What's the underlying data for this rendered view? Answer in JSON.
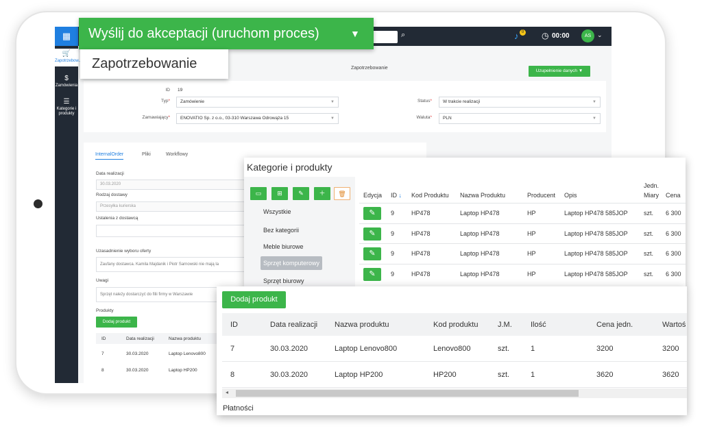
{
  "callout": {
    "label": "Wyślij do akceptacji (uruchom proces)"
  },
  "title_label": "Zapotrzebowanie",
  "topbar": {
    "timer": "00:00",
    "notif_count": "0",
    "avatar_initials": "AS"
  },
  "sidebar": {
    "items": [
      {
        "label": "Zapotrzebow..."
      },
      {
        "label": "Zamówienia"
      },
      {
        "label": "Kategorie i produkty"
      }
    ]
  },
  "page": {
    "title": "Zapotrzebowanie",
    "supplement_button": "Uzupełnienie danych ▼"
  },
  "form": {
    "id_label": "ID",
    "id_value": "19",
    "typ_label": "Typ",
    "typ_value": "Zamówienie",
    "zamawiajacy_label": "Zamawiający",
    "zamawiajacy_value": "ENOVATIO Sp. z o.o., 03-310 Warszawa Odrowąża 15",
    "status_label": "Status",
    "status_value": "W trakcie realizacji",
    "waluta_label": "Waluta",
    "waluta_value": "PLN"
  },
  "lower": {
    "tabs": [
      "InternalOrder",
      "Pliki",
      "Workflowy"
    ],
    "data_realizacji_label": "Data realizacji",
    "data_realizacji_value": "30.03.2020",
    "rodzaj_dostawy_label": "Rodzaj dostawy",
    "rodzaj_dostawy_value": "Przesyłka kurierska",
    "ustalenia_label": "Ustalenia z dostawcą",
    "ustalenia_value": "",
    "uzasadnienie_label": "Uzasadnienie wyboru oferty",
    "uzasadnienie_value": "Zaufany dostawca. Kamila Majdanik i Piotr Sarnowski nie mają la",
    "uwagi_label": "Uwagi",
    "uwagi_value": "Sprzęt należy dostarczyć do filii firmy w Warszawie",
    "produkty_label": "Produkty",
    "add_product": "Dodaj produkt",
    "table_headers": [
      "ID",
      "Data realizacji",
      "Nazwa produktu"
    ],
    "rows": [
      [
        "7",
        "30.03.2020",
        "Laptop Lenovo800"
      ],
      [
        "8",
        "30.03.2020",
        "Laptop HP200"
      ]
    ]
  },
  "categories": {
    "title": "Kategorie i produkty",
    "items": [
      "Wszystkie",
      "Bez kategorii",
      "Meble biurowe",
      "Sprzęt komputerowy",
      "Sprzęt biurowy"
    ],
    "headers": [
      "Edycja",
      "ID",
      "Kod Produktu",
      "Nazwa Produktu",
      "Producent",
      "Opis",
      "Jedn.",
      "Miary",
      "Cena"
    ],
    "rows": [
      [
        "9",
        "HP478",
        "Laptop HP478",
        "HP",
        "Laptop HP478 585JOP",
        "szt.",
        "6 300"
      ],
      [
        "9",
        "HP478",
        "Laptop HP478",
        "HP",
        "Laptop HP478 585JOP",
        "szt.",
        "6 300"
      ],
      [
        "9",
        "HP478",
        "Laptop HP478",
        "HP",
        "Laptop HP478 585JOP",
        "szt.",
        "6 300"
      ],
      [
        "9",
        "HP478",
        "Laptop HP478",
        "HP",
        "Laptop HP478 585JOP",
        "szt.",
        "6 300"
      ]
    ]
  },
  "products": {
    "add_button": "Dodaj produkt",
    "headers": [
      "ID",
      "Data realizacji",
      "Nazwa produktu",
      "Kod produktu",
      "J.M.",
      "Ilość",
      "Cena jedn.",
      "Wartoś"
    ],
    "rows": [
      [
        "7",
        "30.03.2020",
        "Laptop Lenovo800",
        "Lenovo800",
        "szt.",
        "1",
        "3200",
        "3200"
      ],
      [
        "8",
        "30.03.2020",
        "Laptop HP200",
        "HP200",
        "szt.",
        "1",
        "3620",
        "3620"
      ]
    ],
    "footer": "Płatności"
  },
  "colors": {
    "accent_green": "#3cb54a",
    "accent_blue": "#1f7fe0",
    "topbar": "#222a35"
  }
}
